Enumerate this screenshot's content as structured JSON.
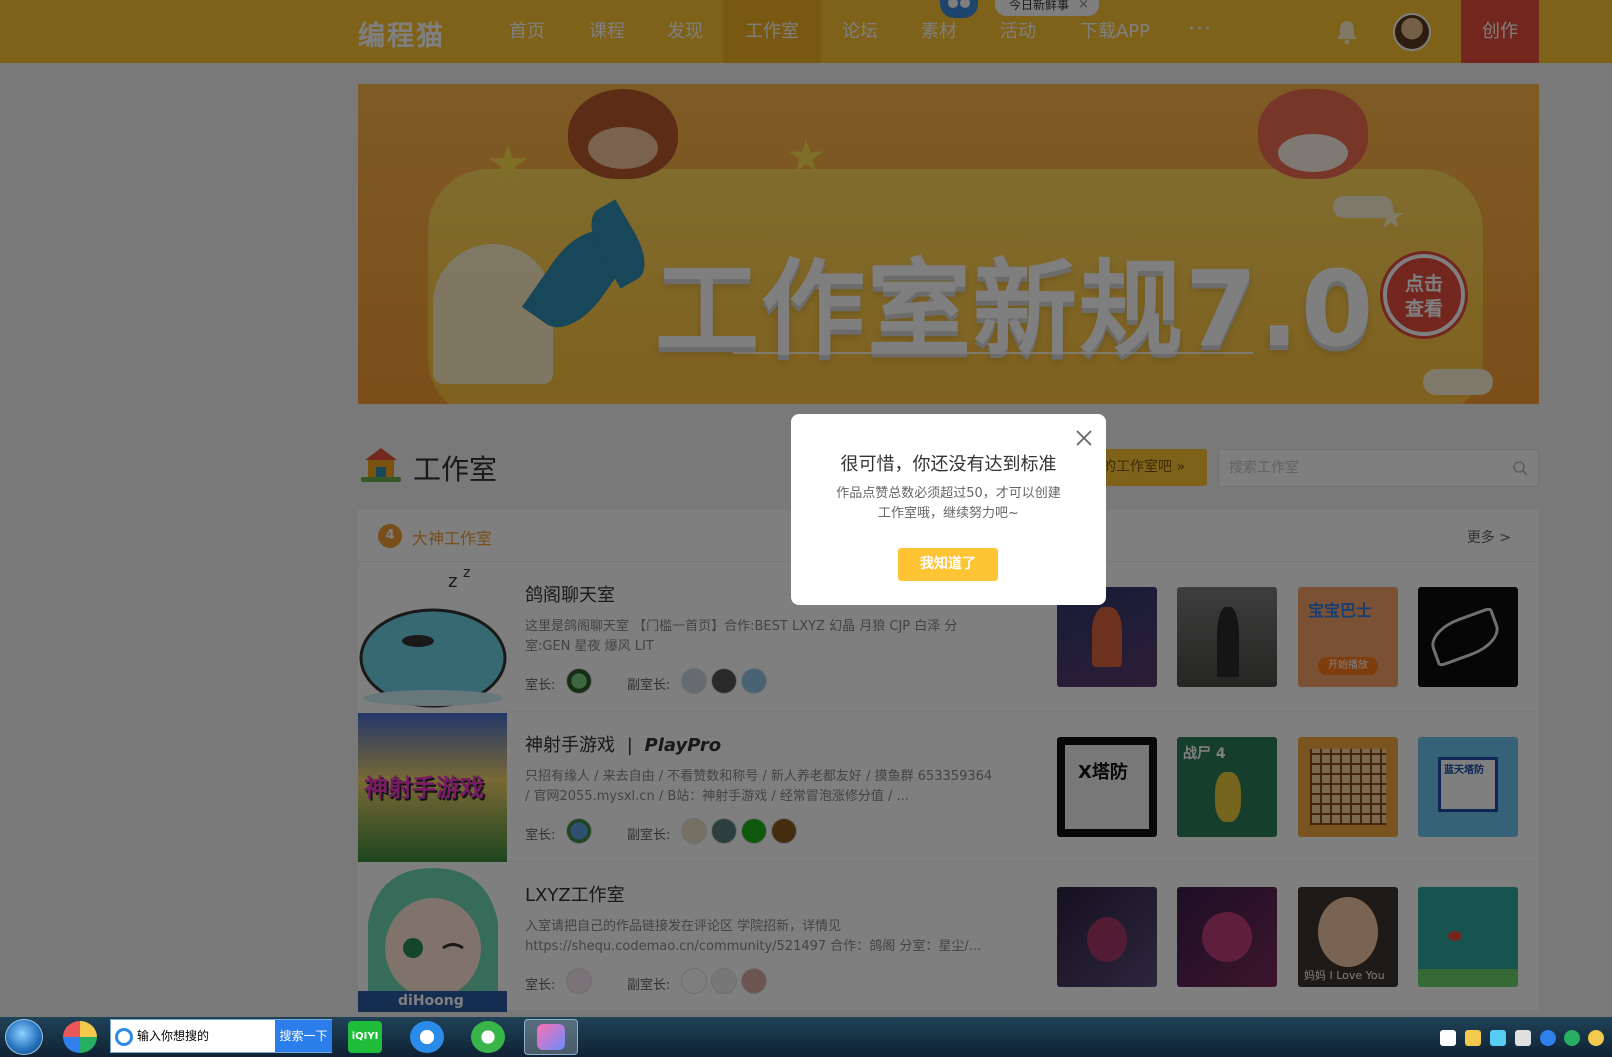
{
  "nav": {
    "logo": "编程猫",
    "items": [
      {
        "label": "首页"
      },
      {
        "label": "课程"
      },
      {
        "label": "发现"
      },
      {
        "label": "工作室",
        "active": true
      },
      {
        "label": "论坛"
      },
      {
        "label": "素材"
      },
      {
        "label": "活动"
      },
      {
        "label": "下载APP"
      }
    ],
    "more": "···",
    "create_label": "创作",
    "news_pill": "今日新鲜事",
    "news_close": "×"
  },
  "banner": {
    "title": "工作室新规7.0",
    "badge_line1": "点击",
    "badge_line2": "查看"
  },
  "section": {
    "title": "工作室",
    "create_button": "的工作室吧 »",
    "search_placeholder": "搜索工作室"
  },
  "category": {
    "badge_number": "4",
    "title": "大神工作室",
    "more": "更多 >"
  },
  "rows": [
    {
      "name": "鸽阁聊天室",
      "desc": "这里是鸽阁聊天室 【门槛一首页】合作:BEST LXYZ 幻晶 月狼 CJP 白泽 分室:GEN 星夜 爆风 LIT",
      "leader_label": "室长:",
      "deputy_label": "副室长:"
    },
    {
      "name": "神射手游戏",
      "name_extra": "PlayPro",
      "desc": "只招有缘人 / 来去自由 / 不看赞数和称号 / 新人养老都友好 / 摸鱼群 653359364 / 官网2055.mysxl.cn / B站：神射手游戏 / 经常冒泡涨修分值 / ...",
      "leader_label": "室长:",
      "deputy_label": "副室长:",
      "cover_text": "神射手游戏"
    },
    {
      "name": "LXYZ工作室",
      "desc": "入室请把自己的作品链接发在评论区 学院招新，详情见 https://shequ.codemao.cn/community/521497 合作：鸽阁 分室：星尘/...",
      "leader_label": "室长:",
      "deputy_label": "副室长:",
      "cover_text": "diHoong"
    }
  ],
  "thumb_texts": {
    "r1t3": "宝宝巴士",
    "r1t3b": "开始播放",
    "r2t1": "X塔防",
    "r2t2": "战尸 4",
    "r2t4": "蓝天塔防",
    "r3t3": "妈妈 I Love You"
  },
  "modal": {
    "title": "很可惜，你还没有达到标准",
    "message": "作品点赞总数必须超过50，才可以创建工作室哦，继续努力吧~",
    "button": "我知道了"
  },
  "taskbar": {
    "search_placeholder": "输入你想搜的",
    "search_button": "搜索一下",
    "iqiyi_label": "iQIYI"
  },
  "colors": {
    "brand_yellow": "#fec433",
    "create_red": "#e44c3a",
    "category_orange": "#f39c36"
  }
}
